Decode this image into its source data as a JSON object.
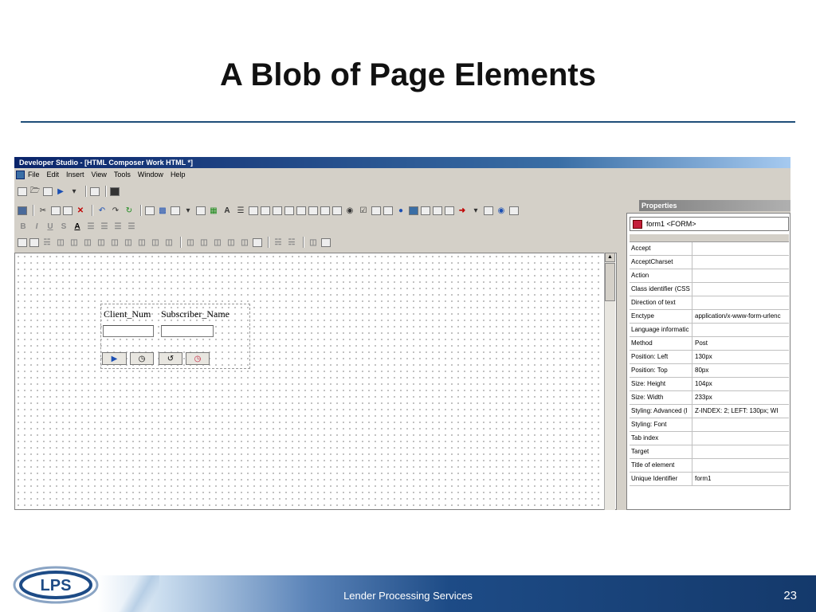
{
  "slide": {
    "title": "A Blob of Page Elements",
    "footer_text": "Lender Processing Services",
    "page_number": "23",
    "logo_text": "LPS"
  },
  "window": {
    "title": "Developer Studio - [HTML Composer Work HTML *]"
  },
  "menu": [
    "File",
    "Edit",
    "Insert",
    "View",
    "Tools",
    "Window",
    "Help"
  ],
  "format_toolbar": {
    "bold": "B",
    "italic": "I",
    "underline": "U",
    "strike": "S",
    "font_color": "A"
  },
  "form": {
    "labels": [
      "Client_Num",
      "Subscriber_Name"
    ]
  },
  "properties": {
    "panel_title": "Properties",
    "selected_object": "form1 <FORM>",
    "rows": [
      {
        "name": "Accept",
        "value": ""
      },
      {
        "name": "AcceptCharset",
        "value": ""
      },
      {
        "name": "Action",
        "value": ""
      },
      {
        "name": "Class identifier (CSS",
        "value": ""
      },
      {
        "name": "Direction of text",
        "value": ""
      },
      {
        "name": "Enctype",
        "value": "application/x-www-form-urlenc"
      },
      {
        "name": "Language informatic",
        "value": ""
      },
      {
        "name": "Method",
        "value": "Post"
      },
      {
        "name": "Position: Left",
        "value": "130px"
      },
      {
        "name": "Position: Top",
        "value": "80px"
      },
      {
        "name": "Size: Height",
        "value": "104px"
      },
      {
        "name": "Size: Width",
        "value": "233px"
      },
      {
        "name": "Styling: Advanced (I",
        "value": "Z-INDEX: 2; LEFT: 130px; WI"
      },
      {
        "name": "Styling: Font",
        "value": ""
      },
      {
        "name": "Tab index",
        "value": ""
      },
      {
        "name": "Target",
        "value": ""
      },
      {
        "name": "Title of element",
        "value": ""
      },
      {
        "name": "Unique Identifier",
        "value": "form1"
      }
    ]
  },
  "colors": {
    "title_rule": "#1f4e79",
    "footer_dark": "#14396b",
    "titlebar": "#0a246a"
  }
}
